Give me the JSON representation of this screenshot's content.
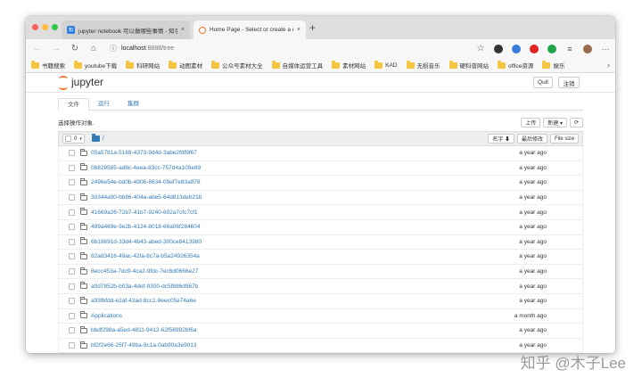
{
  "browser": {
    "tabs": [
      {
        "title": "jupyter notebook 可以做哪些事情 - 知乎",
        "active": false
      },
      {
        "title": "Home Page - Select or create a notebook",
        "active": true
      }
    ],
    "new_tab": "+",
    "tab_close": "×",
    "url_host": "localhost",
    "url_rest": ":8888/tree",
    "bookmarks": [
      "书籍搜索",
      "youtube下载",
      "科研网站",
      "动图素材",
      "公众号素材大全",
      "自媒体运营工具",
      "素材网站",
      "KAD",
      "无损音乐",
      "硬科普网站",
      "office资源",
      "娱乐"
    ],
    "bookmarks_more": "›"
  },
  "jupyter": {
    "logo_text": "jupyter",
    "quit_label": "Quit",
    "logout_label": "注销",
    "tabs": [
      "文件",
      "运行",
      "集群"
    ],
    "hint": "选择操作对象.",
    "upload_label": "上传",
    "new_label": "新建 ▾",
    "refresh_icon": "⟳",
    "select_count": "0",
    "breadcrumb": "/",
    "sort_name": "名字 ⬇",
    "sort_modified": "最后修改",
    "sort_size": "File size",
    "files": [
      {
        "name": "05a5781a-5169-4373-9d4d-3abe2fdf9f67",
        "modified": "a year ago"
      },
      {
        "name": "06829585-ad8c-4eea-83cc-757d4a109e89",
        "modified": "a year ago"
      },
      {
        "name": "2496e54e-bd0b-4906-8634-09ef7e83a978",
        "modified": "a year ago"
      },
      {
        "name": "30344a90-bb86-404a-abe5-64d813deb21b",
        "modified": "a year ago"
      },
      {
        "name": "41669a26-72b7-41b7-9240-602a7cfc7cf1",
        "modified": "a year ago"
      },
      {
        "name": "499a469e-9e2b-4124-8018-66a06f284604",
        "modified": "a year ago"
      },
      {
        "name": "6b19691d-33d4-4b43-abed-300ce8413980",
        "modified": "a year ago"
      },
      {
        "name": "82ad3416-49ac-42fa-8c7a-b5a24926354a",
        "modified": "a year ago"
      },
      {
        "name": "8ecc453a-7dc9-4ca2-9fdc-7ec6d0666e27",
        "modified": "a year ago"
      },
      {
        "name": "a0d7852b-b03a-4def-9300-dc5f886d967b",
        "modified": "a year ago"
      },
      {
        "name": "a93fbfdd-e2af-43ad-8cc1-9eec05e74a6e",
        "modified": "a year ago"
      },
      {
        "name": "Applications",
        "modified": "a month ago"
      },
      {
        "name": "bbdf298a-a5ed-4811-9412-62f56992bf6a",
        "modified": "a year ago"
      },
      {
        "name": "bf2f2e66-25f7-49ba-9c1a-0ab90a3e9013",
        "modified": "a year ago"
      }
    ]
  },
  "watermark": "知乎 @木子Lee"
}
